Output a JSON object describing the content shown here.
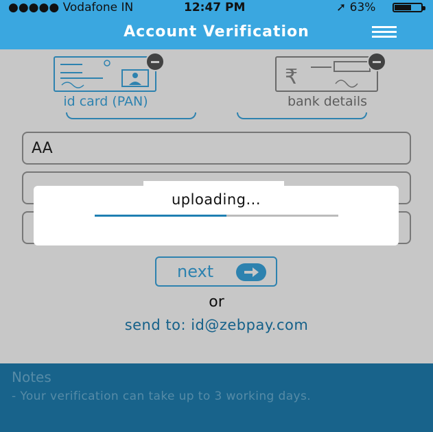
{
  "status_bar": {
    "carrier": "●●●●● Vodafone IN",
    "time": "12:47 PM",
    "battery_percent": "63%",
    "battery_level": 0.63,
    "icons": [
      "signal-dots-icon",
      "wifi-icon",
      "location-arrow-icon",
      "battery-icon"
    ]
  },
  "header": {
    "title": "Account Verification",
    "menu_icon": "hamburger-menu-icon"
  },
  "tabs": [
    {
      "label": "id card (PAN)",
      "icon": "pan-card-icon",
      "badge_icon": "minus-circle-icon"
    },
    {
      "label": "bank details",
      "icon": "bank-cheque-icon",
      "badge_icon": "minus-circle-icon"
    }
  ],
  "form": {
    "fields": [
      {
        "value": "AA"
      },
      {
        "value": ""
      },
      {
        "value": ""
      }
    ],
    "next_label": "next",
    "next_icon": "arrow-right-circle-icon",
    "or_text": "or",
    "send_to_text": "send to: id@zebpay.com"
  },
  "notes": {
    "heading": "Notes",
    "text": "- Your verification can take up to 3 working days."
  },
  "dialog": {
    "message": "uploading...",
    "progress": 0.54
  },
  "colors": {
    "accent": "#3aa7e0",
    "notes_bg": "#1f7fb2"
  }
}
